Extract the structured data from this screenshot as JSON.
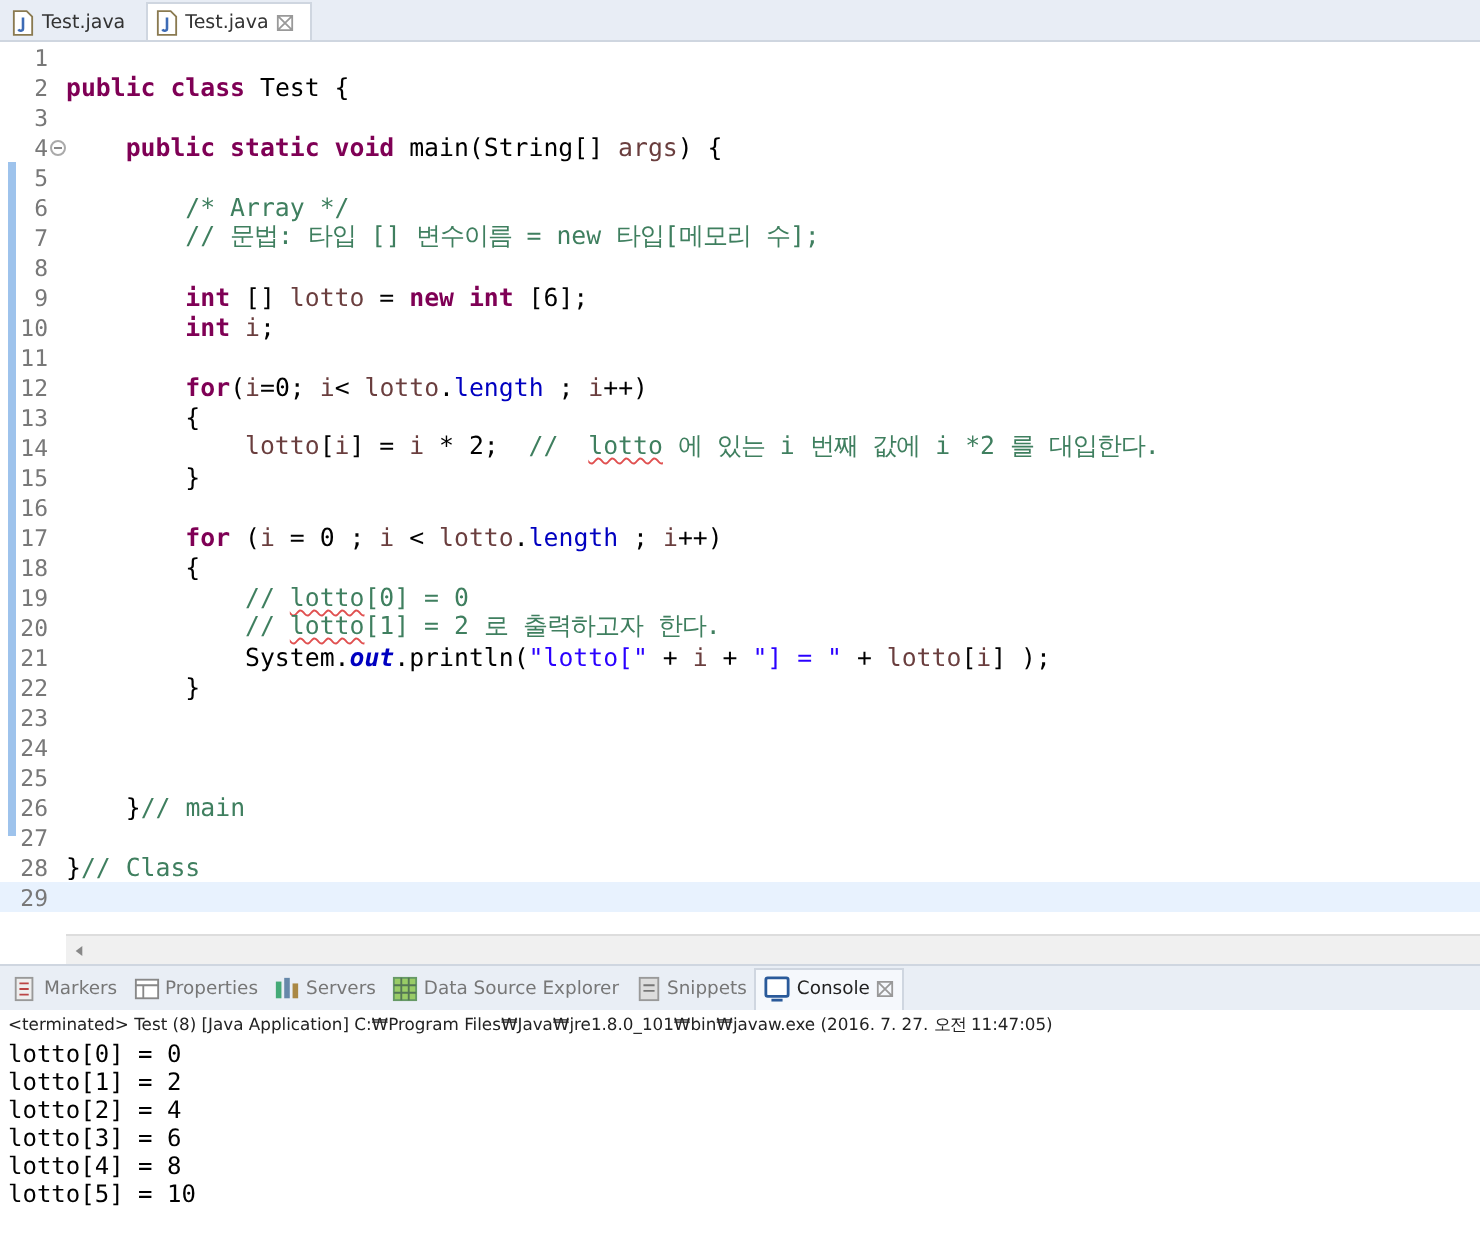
{
  "editor_tabs": [
    {
      "label": "Test.java",
      "selected": false,
      "closable": false
    },
    {
      "label": "Test.java",
      "selected": true,
      "closable": true
    }
  ],
  "code_lines": [
    {
      "number": "1",
      "fold": false,
      "current": false
    },
    {
      "number": "2",
      "fold": false,
      "current": false,
      "tokens": [
        {
          "kind": "keyword",
          "text": "public class"
        },
        {
          "kind": "plain",
          "text": " Test {"
        }
      ]
    },
    {
      "number": "3",
      "fold": false,
      "current": false
    },
    {
      "number": "4",
      "fold": true,
      "current": false,
      "tokens": [
        {
          "kind": "keyword",
          "text": "    public static void"
        },
        {
          "kind": "plain",
          "text": " main(String[] "
        },
        {
          "kind": "variable",
          "text": "args"
        },
        {
          "kind": "plain",
          "text": ") {"
        }
      ]
    },
    {
      "number": "5",
      "fold": false,
      "current": false
    },
    {
      "number": "6",
      "fold": false,
      "current": false,
      "tokens": [
        {
          "kind": "comment",
          "text": "        /* Array */"
        }
      ]
    },
    {
      "number": "7",
      "fold": false,
      "current": false,
      "tokens": [
        {
          "kind": "comment",
          "text": "        // 문법: 타입 [] 변수이름 = new 타입[메모리 수];"
        }
      ]
    },
    {
      "number": "8",
      "fold": false,
      "current": false
    },
    {
      "number": "9",
      "fold": false,
      "current": false,
      "tokens": [
        {
          "kind": "keyword",
          "text": "        int"
        },
        {
          "kind": "plain",
          "text": " [] "
        },
        {
          "kind": "variable",
          "text": "lotto"
        },
        {
          "kind": "plain",
          "text": " = "
        },
        {
          "kind": "keyword",
          "text": "new int"
        },
        {
          "kind": "plain",
          "text": " [6];"
        }
      ]
    },
    {
      "number": "10",
      "fold": false,
      "current": false,
      "tokens": [
        {
          "kind": "keyword",
          "text": "        int"
        },
        {
          "kind": "variable",
          "text": " i"
        },
        {
          "kind": "plain",
          "text": ";"
        }
      ]
    },
    {
      "number": "11",
      "fold": false,
      "current": false
    },
    {
      "number": "12",
      "fold": false,
      "current": false,
      "tokens": [
        {
          "kind": "keyword",
          "text": "        for"
        },
        {
          "kind": "plain",
          "text": "("
        },
        {
          "kind": "variable",
          "text": "i"
        },
        {
          "kind": "plain",
          "text": "=0; "
        },
        {
          "kind": "variable",
          "text": "i"
        },
        {
          "kind": "plain",
          "text": "< "
        },
        {
          "kind": "variable",
          "text": "lotto"
        },
        {
          "kind": "plain",
          "text": "."
        },
        {
          "kind": "field",
          "text": "length"
        },
        {
          "kind": "plain",
          "text": " ; "
        },
        {
          "kind": "variable",
          "text": "i"
        },
        {
          "kind": "plain",
          "text": "++)"
        }
      ]
    },
    {
      "number": "13",
      "fold": false,
      "current": false,
      "tokens": [
        {
          "kind": "plain",
          "text": "        {"
        }
      ]
    },
    {
      "number": "14",
      "fold": false,
      "current": false,
      "tokens": [
        {
          "kind": "variable",
          "text": "            lotto"
        },
        {
          "kind": "plain",
          "text": "["
        },
        {
          "kind": "variable",
          "text": "i"
        },
        {
          "kind": "plain",
          "text": "] = "
        },
        {
          "kind": "variable",
          "text": "i"
        },
        {
          "kind": "plain",
          "text": " * 2;  "
        },
        {
          "kind": "comment",
          "text": "//  "
        },
        {
          "kind": "misspelled",
          "text": "lotto"
        },
        {
          "kind": "comment",
          "text": " 에 있는 i 번째 값에 i *2 를 대입한다."
        }
      ]
    },
    {
      "number": "15",
      "fold": false,
      "current": false,
      "tokens": [
        {
          "kind": "plain",
          "text": "        }"
        }
      ]
    },
    {
      "number": "16",
      "fold": false,
      "current": false
    },
    {
      "number": "17",
      "fold": false,
      "current": false,
      "tokens": [
        {
          "kind": "keyword",
          "text": "        for"
        },
        {
          "kind": "plain",
          "text": " ("
        },
        {
          "kind": "variable",
          "text": "i"
        },
        {
          "kind": "plain",
          "text": " = 0 ; "
        },
        {
          "kind": "variable",
          "text": "i"
        },
        {
          "kind": "plain",
          "text": " < "
        },
        {
          "kind": "variable",
          "text": "lotto"
        },
        {
          "kind": "plain",
          "text": "."
        },
        {
          "kind": "field",
          "text": "length"
        },
        {
          "kind": "plain",
          "text": " ; "
        },
        {
          "kind": "variable",
          "text": "i"
        },
        {
          "kind": "plain",
          "text": "++)"
        }
      ]
    },
    {
      "number": "18",
      "fold": false,
      "current": false,
      "tokens": [
        {
          "kind": "plain",
          "text": "        {"
        }
      ]
    },
    {
      "number": "19",
      "fold": false,
      "current": false,
      "tokens": [
        {
          "kind": "comment",
          "text": "            // "
        },
        {
          "kind": "misspelled",
          "text": "lotto"
        },
        {
          "kind": "comment",
          "text": "[0] = 0"
        }
      ]
    },
    {
      "number": "20",
      "fold": false,
      "current": false,
      "tokens": [
        {
          "kind": "comment",
          "text": "            // "
        },
        {
          "kind": "misspelled",
          "text": "lotto"
        },
        {
          "kind": "comment",
          "text": "[1] = 2 로 출력하고자 한다."
        }
      ]
    },
    {
      "number": "21",
      "fold": false,
      "current": false,
      "tokens": [
        {
          "kind": "plain",
          "text": "            System."
        },
        {
          "kind": "static",
          "text": "out"
        },
        {
          "kind": "plain",
          "text": ".println("
        },
        {
          "kind": "string",
          "text": "\"lotto[\""
        },
        {
          "kind": "plain",
          "text": " + "
        },
        {
          "kind": "variable",
          "text": "i"
        },
        {
          "kind": "plain",
          "text": " + "
        },
        {
          "kind": "string",
          "text": "\"] = \""
        },
        {
          "kind": "plain",
          "text": " + "
        },
        {
          "kind": "variable",
          "text": "lotto"
        },
        {
          "kind": "plain",
          "text": "["
        },
        {
          "kind": "variable",
          "text": "i"
        },
        {
          "kind": "plain",
          "text": "] );"
        }
      ]
    },
    {
      "number": "22",
      "fold": false,
      "current": false,
      "tokens": [
        {
          "kind": "plain",
          "text": "        }"
        }
      ]
    },
    {
      "number": "23",
      "fold": false,
      "current": false
    },
    {
      "number": "24",
      "fold": false,
      "current": false
    },
    {
      "number": "25",
      "fold": false,
      "current": false
    },
    {
      "number": "26",
      "fold": false,
      "current": false,
      "tokens": [
        {
          "kind": "plain",
          "text": "    }"
        },
        {
          "kind": "comment",
          "text": "// main"
        }
      ]
    },
    {
      "number": "27",
      "fold": false,
      "current": false
    },
    {
      "number": "28",
      "fold": false,
      "current": false,
      "tokens": [
        {
          "kind": "plain",
          "text": "}"
        },
        {
          "kind": "comment",
          "text": "// Class"
        }
      ]
    },
    {
      "number": "29",
      "fold": false,
      "current": true
    }
  ],
  "panel_tabs": [
    {
      "label": "Markers",
      "selected": false,
      "closable": false
    },
    {
      "label": "Properties",
      "selected": false,
      "closable": false
    },
    {
      "label": "Servers",
      "selected": false,
      "closable": false
    },
    {
      "label": "Data Source Explorer",
      "selected": false,
      "closable": false
    },
    {
      "label": "Snippets",
      "selected": false,
      "closable": false
    },
    {
      "label": "Console",
      "selected": true,
      "closable": true
    }
  ],
  "console": {
    "header": "<terminated> Test (8) [Java Application] C:₩Program Files₩Java₩jre1.8.0_101₩bin₩javaw.exe (2016. 7. 27. 오전 11:47:05)",
    "output": [
      "lotto[0] = 0",
      "lotto[1] = 2",
      "lotto[2] = 4",
      "lotto[3] = 6",
      "lotto[4] = 8",
      "lotto[5] = 10"
    ]
  }
}
